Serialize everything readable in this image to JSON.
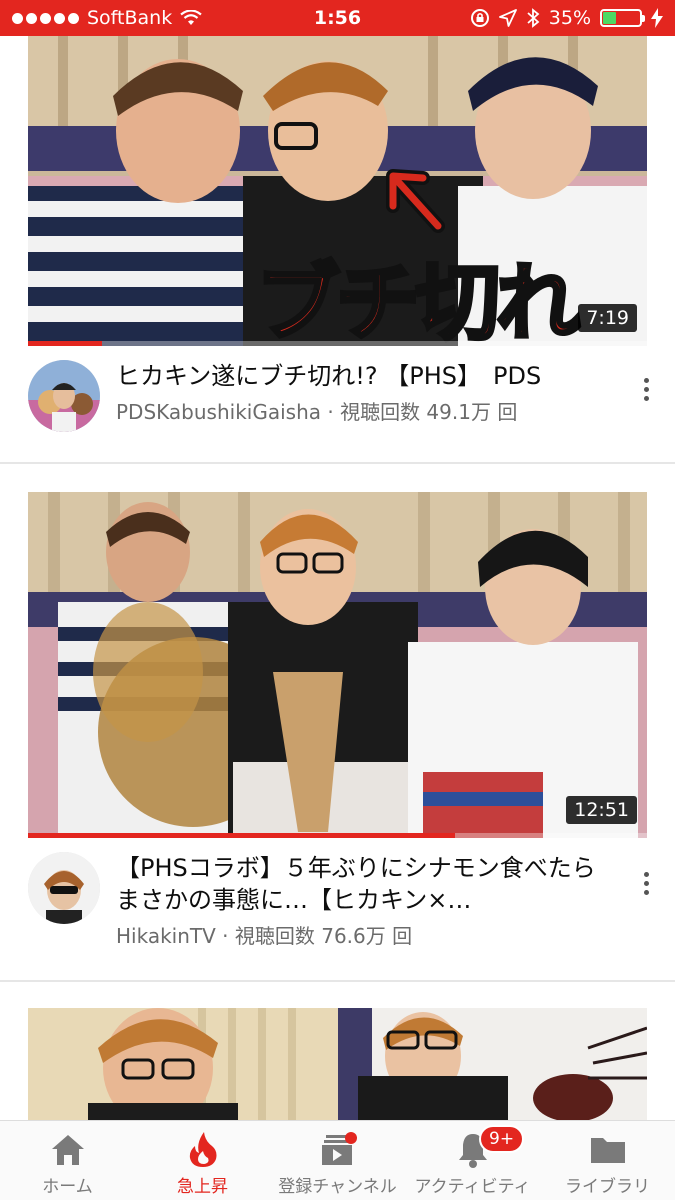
{
  "status_bar": {
    "carrier": "SoftBank",
    "time": "1:56",
    "battery": "35%",
    "battery_level": 0.35
  },
  "videos": [
    {
      "title": "ヒカキン遂にブチ切れ!? 【PHS】　PDS",
      "channel_line": "PDSKabushikiGaisha · 視聴回数 49.1万 回",
      "duration": "7:19",
      "overlay_text": "ブチ切れ",
      "watched_fraction": 0.12
    },
    {
      "title": "【PHSコラボ】５年ぶりにシナモン食べたらまさかの事態に…【ヒカキン×…",
      "channel_line": "HikakinTV · 視聴回数 76.6万 回",
      "duration": "12:51",
      "watched_fraction": 0.69
    },
    {
      "title": "",
      "channel_line": ""
    }
  ],
  "bottom_nav": {
    "items": [
      {
        "label": "ホーム",
        "icon": "home-icon"
      },
      {
        "label": "急上昇",
        "icon": "flame-icon",
        "active": true
      },
      {
        "label": "登録チャンネル",
        "icon": "subscriptions-icon"
      },
      {
        "label": "アクティビティ",
        "icon": "bell-icon",
        "badge": "9+"
      },
      {
        "label": "ライブラリ",
        "icon": "folder-icon"
      }
    ]
  },
  "colors": {
    "accent": "#e3261f",
    "text": "#0e0e0e",
    "secondary_text": "#6b6b6b"
  }
}
